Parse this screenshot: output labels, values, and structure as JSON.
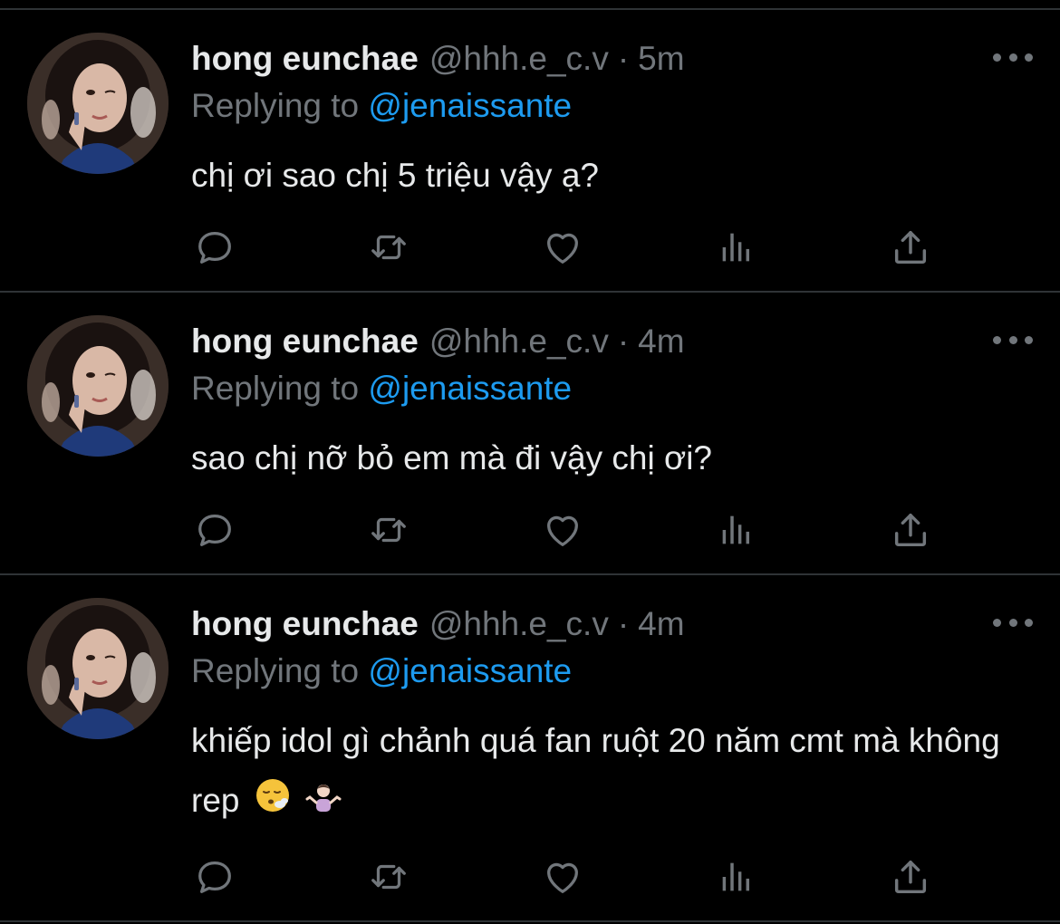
{
  "colors": {
    "background": "#000000",
    "text_primary": "#e7e9ea",
    "text_secondary": "#71767b",
    "accent": "#1d9bf0",
    "divider": "#2f3336"
  },
  "icons": [
    "more-icon",
    "reply-icon",
    "retweet-icon",
    "like-icon",
    "views-icon",
    "share-icon"
  ],
  "tweets": [
    {
      "display_name": "hong eunchae",
      "handle": "@hhh.e_c.v",
      "separator": "·",
      "time": "5m",
      "replying_prefix": "Replying to",
      "replying_to": "@jenaissante",
      "text": "chị ơi sao chị 5 triệu vậy ạ?"
    },
    {
      "display_name": "hong eunchae",
      "handle": "@hhh.e_c.v",
      "separator": "·",
      "time": "4m",
      "replying_prefix": "Replying to",
      "replying_to": "@jenaissante",
      "text": "sao chị nỡ bỏ em mà đi vậy chị ơi?"
    },
    {
      "display_name": "hong eunchae",
      "handle": "@hhh.e_c.v",
      "separator": "·",
      "time": "4m",
      "replying_prefix": "Replying to",
      "replying_to": "@jenaissante",
      "text": "khiếp idol gì chảnh quá fan ruột 20 năm cmt mà không rep",
      "emojis": [
        "face-exhaling-emoji",
        "person-shrugging-emoji"
      ]
    }
  ]
}
